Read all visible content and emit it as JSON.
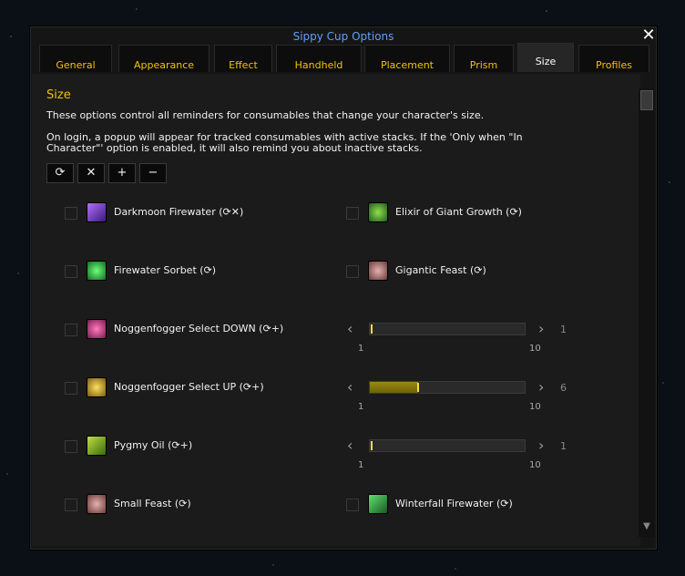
{
  "window": {
    "title": "Sippy Cup Options",
    "close_label": "✕"
  },
  "tabs": [
    {
      "label": "General"
    },
    {
      "label": "Appearance"
    },
    {
      "label": "Effect"
    },
    {
      "label": "Handheld"
    },
    {
      "label": "Placement"
    },
    {
      "label": "Prism"
    },
    {
      "label": "Size",
      "active": true
    },
    {
      "label": "Profiles"
    }
  ],
  "section": {
    "title": "Size",
    "desc1": "These options control all reminders for consumables that change your character's size.",
    "desc2": "On login, a popup will appear for tracked consumables with active stacks. If the 'Only when \"In",
    "desc3": "Character\"' option is enabled, it will also remind you about inactive stacks."
  },
  "toolbar": {
    "refresh_icon": "refresh-icon",
    "refresh": "⟳",
    "clear": "✕",
    "add": "+",
    "remove": "−"
  },
  "items": {
    "darkmoon": {
      "label": "Darkmoon Firewater (",
      "icons": "⟳✕",
      "close": ")",
      "icon_color": "#8a4fff"
    },
    "elixir": {
      "label": "Elixir of Giant Growth (",
      "icons": "⟳",
      "close": ")",
      "icon_color": "#2f9a2f"
    },
    "sorbet": {
      "label": "Firewater Sorbet (",
      "icons": "⟳",
      "close": ")",
      "icon_color": "#35c04a"
    },
    "gigantic": {
      "label": "Gigantic Feast (",
      "icons": "⟳",
      "close": ")",
      "icon_color": "#c88a8a"
    },
    "nogg_down": {
      "label": "Noggenfogger Select DOWN (",
      "icons": "⟳+",
      "close": ")",
      "icon_color": "#e03a8a"
    },
    "nogg_up": {
      "label": "Noggenfogger Select UP (",
      "icons": "⟳+",
      "close": ")",
      "icon_color": "#d8a020"
    },
    "pygmy": {
      "label": "Pygmy Oil (",
      "icons": "⟳+",
      "close": ")",
      "icon_color": "#8fc020"
    },
    "small_feast": {
      "label": "Small Feast (",
      "icons": "⟳",
      "close": ")",
      "icon_color": "#c88a8a"
    },
    "winterfall": {
      "label": "Winterfall Firewater (",
      "icons": "⟳",
      "close": ")",
      "icon_color": "#30b040"
    }
  },
  "sliders": {
    "nogg_down": {
      "value": 1,
      "min": 1,
      "max": 10,
      "value_text": "1",
      "min_text": "1",
      "max_text": "10"
    },
    "nogg_up": {
      "value": 6,
      "min": 1,
      "max": 10,
      "value_text": "6",
      "min_text": "1",
      "max_text": "10"
    },
    "pygmy": {
      "value": 1,
      "min": 1,
      "max": 10,
      "value_text": "1",
      "min_text": "1",
      "max_text": "10"
    }
  },
  "colors": {
    "accent": "#f2c200",
    "title": "#5fa0ff"
  }
}
